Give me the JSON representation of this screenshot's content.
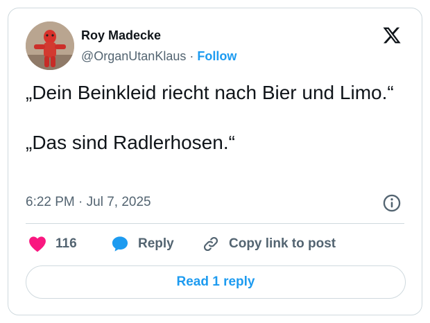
{
  "author": {
    "name": "Roy Madecke",
    "handle": "@OrganUtanKlaus",
    "separator": "·",
    "follow_label": "Follow"
  },
  "tweet": {
    "text": "„Dein Beinkleid riecht nach Bier und Limo.“\n\n„Das sind Radlerhosen.“",
    "timestamp": "6:22 PM · Jul 7, 2025"
  },
  "actions": {
    "like_count": "116",
    "reply_label": "Reply",
    "copy_label": "Copy link to post"
  },
  "footer": {
    "read_reply_label": "Read 1 reply"
  },
  "icons": {
    "like": "heart-icon",
    "reply": "speech-bubble-icon",
    "copy": "link-icon",
    "info": "info-icon",
    "logo": "x-logo-icon"
  },
  "colors": {
    "accent": "#1d9bf0",
    "like": "#f91880",
    "muted": "#536471",
    "text": "#0f1419",
    "border": "#cfd9de"
  }
}
